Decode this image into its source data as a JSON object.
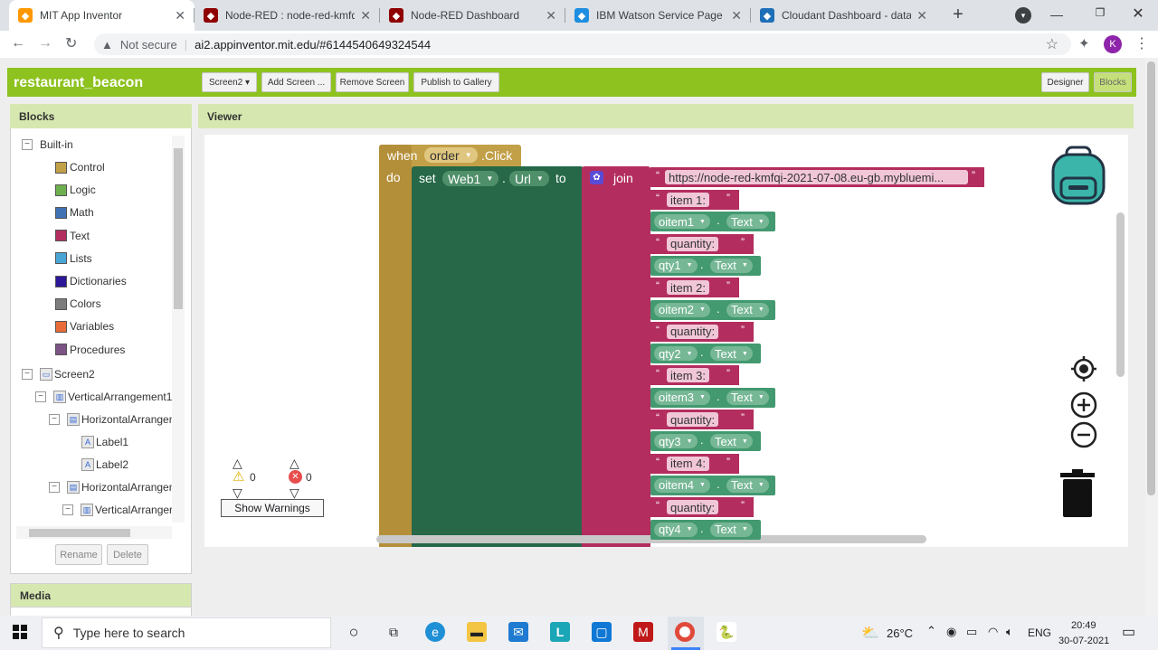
{
  "browser": {
    "tabs": [
      {
        "title": "MIT App Inventor",
        "icon": "app-inventor-icon",
        "color": "#ff9800"
      },
      {
        "title": "Node-RED : node-red-kmfqi-",
        "icon": "node-red-icon",
        "color": "#8f0000"
      },
      {
        "title": "Node-RED Dashboard",
        "icon": "node-red-dashboard-icon",
        "color": "#8f0000"
      },
      {
        "title": "IBM Watson Service Page",
        "icon": "cloud-icon",
        "color": "#1d8ee0"
      },
      {
        "title": "Cloudant Dashboard - datab",
        "icon": "cloudant-icon",
        "color": "#1d6fb8"
      }
    ],
    "new_tab": "+",
    "not_secure": "Not secure",
    "url": "ai2.appinventor.mit.edu/#6144540649324544",
    "profile_initial": "K"
  },
  "app": {
    "project_name": "restaurant_beacon",
    "screen_dropdown": "Screen2 ▾",
    "add_screen": "Add Screen ...",
    "remove_screen": "Remove Screen",
    "publish": "Publish to Gallery",
    "designer": "Designer",
    "blocks": "Blocks",
    "accent": "#8dc21f"
  },
  "blocks_panel": {
    "title": "Blocks",
    "builtin": "Built-in",
    "categories": [
      {
        "label": "Control",
        "color": "#c2a047"
      },
      {
        "label": "Logic",
        "color": "#6fb04e"
      },
      {
        "label": "Math",
        "color": "#3f71b5"
      },
      {
        "label": "Text",
        "color": "#b32d5e"
      },
      {
        "label": "Lists",
        "color": "#49a5d6"
      },
      {
        "label": "Dictionaries",
        "color": "#2d1799"
      },
      {
        "label": "Colors",
        "color": "#7d7d7d"
      },
      {
        "label": "Variables",
        "color": "#e86b38"
      },
      {
        "label": "Procedures",
        "color": "#7c5385"
      }
    ],
    "components": {
      "screen": "Screen2",
      "vertical1": "VerticalArrangement1",
      "horizontal1": "HorizontalArrangen",
      "label1": "Label1",
      "label2": "Label2",
      "horizontal2": "HorizontalArrangen",
      "vertical2": "VerticalArranger"
    },
    "rename": "Rename",
    "delete": "Delete",
    "media": "Media"
  },
  "viewer": {
    "title": "Viewer",
    "event": {
      "when": "when",
      "component": "order",
      "event_name": ".Click",
      "do": "do"
    },
    "setter": {
      "set": "set",
      "component": "Web1",
      "property": "Url",
      "to": "to",
      "join": "join"
    },
    "url_string": "https://node-red-kmfqi-2021-07-08.eu-gb.mybluemi...",
    "join_items": [
      {
        "kind": "text",
        "value": "item 1:"
      },
      {
        "kind": "comp",
        "component": "oitem1",
        "prop": "Text"
      },
      {
        "kind": "text",
        "value": "quantity:"
      },
      {
        "kind": "comp",
        "component": "qty1",
        "prop": "Text"
      },
      {
        "kind": "text",
        "value": "item 2:"
      },
      {
        "kind": "comp",
        "component": "oitem2",
        "prop": "Text"
      },
      {
        "kind": "text",
        "value": "quantity:"
      },
      {
        "kind": "comp",
        "component": "qty2",
        "prop": "Text"
      },
      {
        "kind": "text",
        "value": "item 3:"
      },
      {
        "kind": "comp",
        "component": "oitem3",
        "prop": "Text"
      },
      {
        "kind": "text",
        "value": "quantity:"
      },
      {
        "kind": "comp",
        "component": "qty3",
        "prop": "Text"
      },
      {
        "kind": "text",
        "value": "item 4:"
      },
      {
        "kind": "comp",
        "component": "oitem4",
        "prop": "Text"
      },
      {
        "kind": "text",
        "value": "quantity:"
      },
      {
        "kind": "comp",
        "component": "qty4",
        "prop": "Text"
      }
    ],
    "warnings_count": "0",
    "errors_count": "0",
    "show_warnings": "Show Warnings"
  },
  "taskbar": {
    "search_placeholder": "Type here to search",
    "temperature": "26°C",
    "language": "ENG",
    "time": "20:49",
    "date": "30-07-2021"
  }
}
